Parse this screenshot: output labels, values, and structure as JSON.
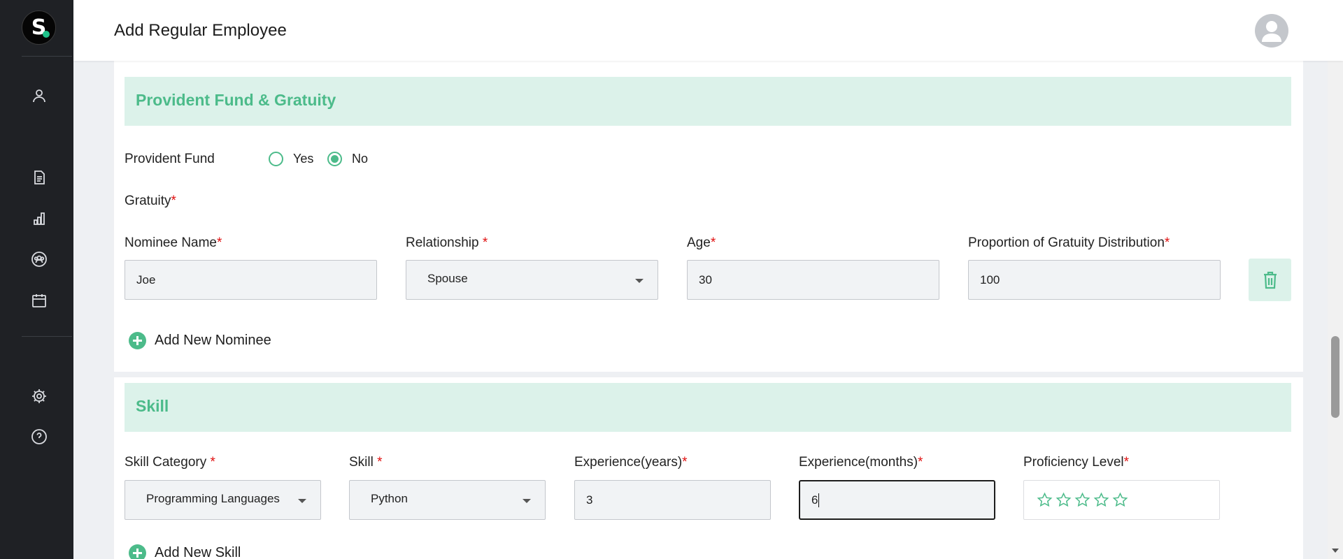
{
  "app": {
    "logo_letter": "S",
    "accent": "#4cbb8a",
    "section_bg": "#dcf2ea"
  },
  "header": {
    "title": "Add Regular Employee"
  },
  "sidebar": {
    "items": [
      {
        "icon": "user-icon"
      },
      {
        "icon": "document-icon"
      },
      {
        "icon": "bar-chart-icon"
      },
      {
        "icon": "team-icon"
      },
      {
        "icon": "calendar-icon"
      },
      {
        "icon": "gear-icon"
      },
      {
        "icon": "help-icon"
      }
    ]
  },
  "pf_section": {
    "title": "Provident Fund & Gratuity",
    "provident_fund_label": "Provident Fund",
    "options": [
      "Yes",
      "No"
    ],
    "selected": "No",
    "gratuity_label": "Gratuity",
    "nominee_name_label": "Nominee Name",
    "relationship_label": "Relationship ",
    "age_label": "Age",
    "proportion_label": "Proportion of Gratuity Distribution",
    "required_mark": "*",
    "nominee": {
      "name": "Joe",
      "relationship": "Spouse",
      "age": "30",
      "proportion": "100"
    },
    "add_nominee_label": "Add New Nominee"
  },
  "skill_section": {
    "title": "Skill",
    "skill_category_label": "Skill Category ",
    "skill_label": "Skill ",
    "exp_years_label": "Experience(years)",
    "exp_months_label": "Experience(months)",
    "proficiency_label": "Proficiency Level",
    "required_mark": "*",
    "row": {
      "category": "Programming Languages",
      "skill": "Python",
      "years": "3",
      "months": "6",
      "proficiency_stars": 0,
      "max_stars": 5
    },
    "add_skill_label": "Add New Skill"
  }
}
